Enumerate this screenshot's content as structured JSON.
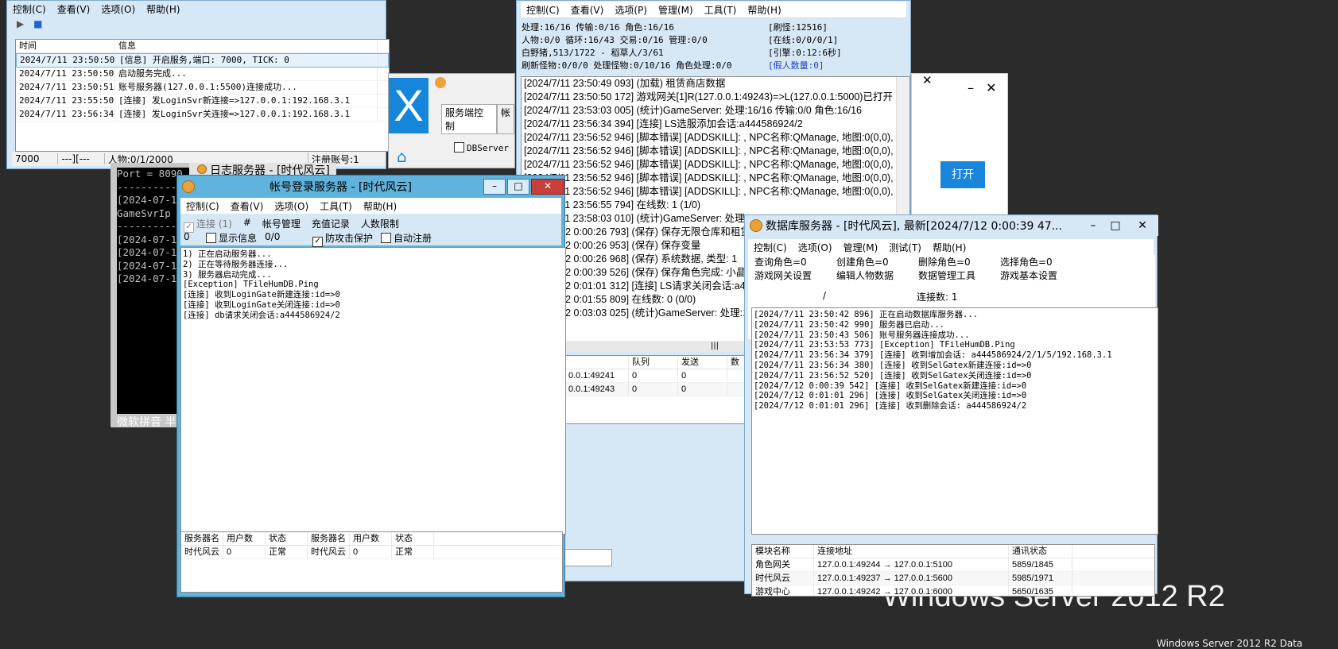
{
  "logserver": {
    "menu": [
      "控制(C)",
      "查看(V)",
      "选项(O)",
      "帮助(H)"
    ],
    "columns": [
      "时间",
      "信息"
    ],
    "rows": [
      {
        "time": "2024/7/11 23:50:50",
        "info": "[信息] 开启服务,端口: 7000, TICK: 0"
      },
      {
        "time": "2024/7/11 23:50:50",
        "info": "启动服务完成..."
      },
      {
        "time": "2024/7/11 23:50:51",
        "info": "账号服务器(127.0.0.1:5500)连接成功..."
      },
      {
        "time": "2024/7/11 23:55:50",
        "info": "[连接] 发LoginSvr新连接=>127.0.0.1:192.168.3.1"
      },
      {
        "time": "2024/7/11 23:56:34",
        "info": "[连接] 发LoginSvr关连接=>127.0.0.1:192.168.3.1"
      }
    ],
    "status": [
      "7000",
      "---][---",
      "人物:0/1/2000",
      "",
      "注册账号:1"
    ]
  },
  "console": {
    "lines": [
      "Port = 8090",
      "------------",
      "[2024-07-1",
      "GameSvrIp",
      "------------",
      "[2024-07-1",
      "[2024-07-1",
      "[2024-07-1",
      "[2024-07-1"
    ],
    "ime": "微软拼音 半"
  },
  "behind_title": "日志服务器 - [时代风云]",
  "dlg": {
    "tabs": [
      "服务端控制",
      "帐"
    ],
    "check": "DBServer",
    "button": "打开"
  },
  "m2": {
    "menu": [
      "控制(C)",
      "查看(V)",
      "选项(P)",
      "管理(M)",
      "工具(T)",
      "帮助(H)"
    ],
    "stats_left": [
      "处理:16/16 传输:0/16 角色:16/16",
      "人物:0/0 循环:16/43 交易:0/16 管理:0/0",
      "白野猪,513/1722 - 稻草人/3/61",
      "刷新怪物:0/0/0 处理怪物:0/10/16 角色处理:0/0"
    ],
    "stats_right": [
      "[刷怪:12516]",
      "[在线:0/0/0/1]",
      "[引擎:0:12:6秒]",
      "[假人数量:0]"
    ],
    "log": [
      "[2024/7/11 23:50:49 093] (加载) 租赁商店数据",
      "[2024/7/11 23:50:50 172] 游戏网关[1]R(127.0.0.1:49243)=>L(127.0.0.1:5000)已打开",
      "[2024/7/11 23:53:03 005] (统计)GameServer: 处理:16/16 传输:0/0 角色:16/16",
      "[2024/7/11 23:56:34 394] [连接] LS选服添加会话:a444586924/2",
      "[2024/7/11 23:56:52 946] [脚本错误] [ADDSKILL]: , NPC名称:QManage, 地图:0(0,0),",
      "[2024/7/11 23:56:52 946] [脚本错误] [ADDSKILL]: , NPC名称:QManage, 地图:0(0,0),",
      "[2024/7/11 23:56:52 946] [脚本错误] [ADDSKILL]: , NPC名称:QManage, 地图:0(0,0),",
      "[2024/7/11 23:56:52 946] [脚本错误] [ADDSKILL]: , NPC名称:QManage, 地图:0(0,0),",
      "[2024/7/11 23:56:52 946] [脚本错误] [ADDSKILL]: , NPC名称:QManage, 地图:0(0,0),",
      "[2024/7/11 23:56:55 794] 在线数: 1 (1/0)",
      "[2024/7/11 23:58:03 010] (统计)GameServer: 处理",
      "[2024/7/12 0:00:26 793] (保存) 保存无限仓库和租赁",
      "[2024/7/12 0:00:26 953] (保存) 保存变量",
      "[2024/7/12 0:00:26 968] (保存) 系统数据, 类型: 1",
      "[2024/7/12 0:00:39 526] (保存) 保存角色完成: 小晶",
      "[2024/7/12 0:01:01 312] [连接] LS请求关闭会话:a44",
      "[2024/7/12 0:01:55 809] 在线数: 0 (0/0)",
      "[2024/7/12 0:03:03 025] (统计)GameServer: 处理:1"
    ],
    "grid_cols": [
      "",
      "队列",
      "发送",
      "数"
    ],
    "grid_rows": [
      [
        "0.0.1:49241",
        "0",
        "0",
        ""
      ],
      [
        "0.0.1:49243",
        "0",
        "0",
        ""
      ]
    ]
  },
  "login": {
    "title": "帐号登录服务器 - [时代风云]",
    "menu": [
      "控制(C)",
      "查看(V)",
      "选项(O)",
      "工具(T)",
      "帮助(H)"
    ],
    "toolbar": [
      "连接 (1)",
      "#",
      "帐号管理",
      "充值记录",
      "人数限制"
    ],
    "row2": {
      "zero": "0",
      "show": "显示信息",
      "ratio": "0/0",
      "protect": "防攻击保护",
      "auto": "自动注册"
    },
    "log": [
      "1) 正在启动服务器...",
      "2) 正在等待服务器连接...",
      "3) 服务器启动完成...",
      "[Exception] TFileHumDB.Ping",
      "[连接] 收到LoginGate新建连接:id=>0",
      "[连接] 收到LoginGate关闭连接:id=>0",
      "[连接] db请求关闭会话:a444586924/2"
    ],
    "grid_cols": [
      "服务器名",
      "用户数",
      "状态",
      "服务器名",
      "用户数",
      "状态"
    ],
    "grid_row": [
      "时代风云",
      "0",
      "正常",
      "时代风云",
      "0",
      "正常"
    ]
  },
  "db": {
    "title": "数据库服务器 - [时代风云], 最新[2024/7/12 0:00:39 47...",
    "menu": [
      "控制(C)",
      "选项(O)",
      "管理(M)",
      "测试(T)",
      "帮助(H)"
    ],
    "row1": [
      "查询角色=0",
      "创建角色=0",
      "删除角色=0",
      "选择角色=0"
    ],
    "row2": [
      "游戏网关设置",
      "编辑人物数据",
      "数据管理工具",
      "游戏基本设置"
    ],
    "slash": "/",
    "conn": "连接数: 1",
    "log": [
      "[2024/7/11 23:50:42 896] 正在启动数据库服务器...",
      "[2024/7/11 23:50:42 990] 服务器已启动...",
      "[2024/7/11 23:50:43 506] 账号服务器连接成功...",
      "[2024/7/11 23:53:53 773] [Exception] TFileHumDB.Ping",
      "[2024/7/11 23:56:34 379] [连接] 收到增加会话: a444586924/2/1/5/192.168.3.1",
      "[2024/7/11 23:56:34 380] [连接] 收到SelGatex新建连接:id=>0",
      "[2024/7/11 23:56:52 520] [连接] 收到SelGatex关闭连接:id=>0",
      "[2024/7/12 0:00:39 542] [连接] 收到SelGatex新建连接:id=>0",
      "[2024/7/12 0:01:01 296] [连接] 收到SelGatex关闭连接:id=>0",
      "[2024/7/12 0:01:01 296] [连接] 收到删除会话: a444586924/2"
    ],
    "grid_cols": [
      "模块名称",
      "连接地址",
      "通讯状态"
    ],
    "grid_rows": [
      [
        "角色网关",
        "127.0.0.1:49244 → 127.0.0.1:5100",
        "5859/1845"
      ],
      [
        "时代风云",
        "127.0.0.1:49237 → 127.0.0.1:5600",
        "5985/1971"
      ],
      [
        "游戏中心",
        "127.0.0.1:49242 → 127.0.0.1:6000",
        "5650/1635"
      ]
    ]
  },
  "desktop": {
    "watermark": "Windows Server 2012 R2",
    "corner": "Windows Server 2012 R2 Data"
  }
}
